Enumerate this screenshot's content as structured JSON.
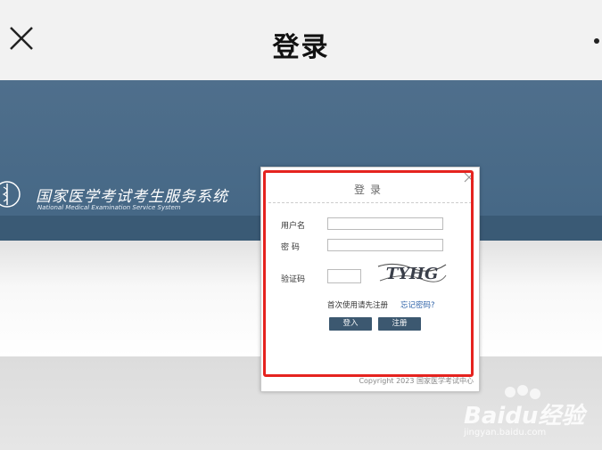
{
  "topbar": {
    "title": "登录"
  },
  "site": {
    "name_cn": "国家医学考试考生服务系统",
    "name_en": "National Medical Examination Service System"
  },
  "dialog": {
    "title": "登录",
    "username_label": "用户名",
    "username_value": "",
    "password_label": "密 码",
    "password_value": "",
    "captcha_label": "验证码",
    "captcha_value": "",
    "captcha_text": "TYHG",
    "register_hint": "首次使用请先注册",
    "forgot_link": "忘记密码?",
    "login_button": "登入",
    "register_button": "注册",
    "copyright": "Copyright 2023 国家医学考试中心"
  },
  "watermark": {
    "brand": "Baidu经验",
    "url": "jingyan.baidu.com"
  },
  "colors": {
    "banner": "#4b6b89",
    "button": "#3c5870",
    "highlight": "#e5231f",
    "link": "#2d62a8"
  }
}
